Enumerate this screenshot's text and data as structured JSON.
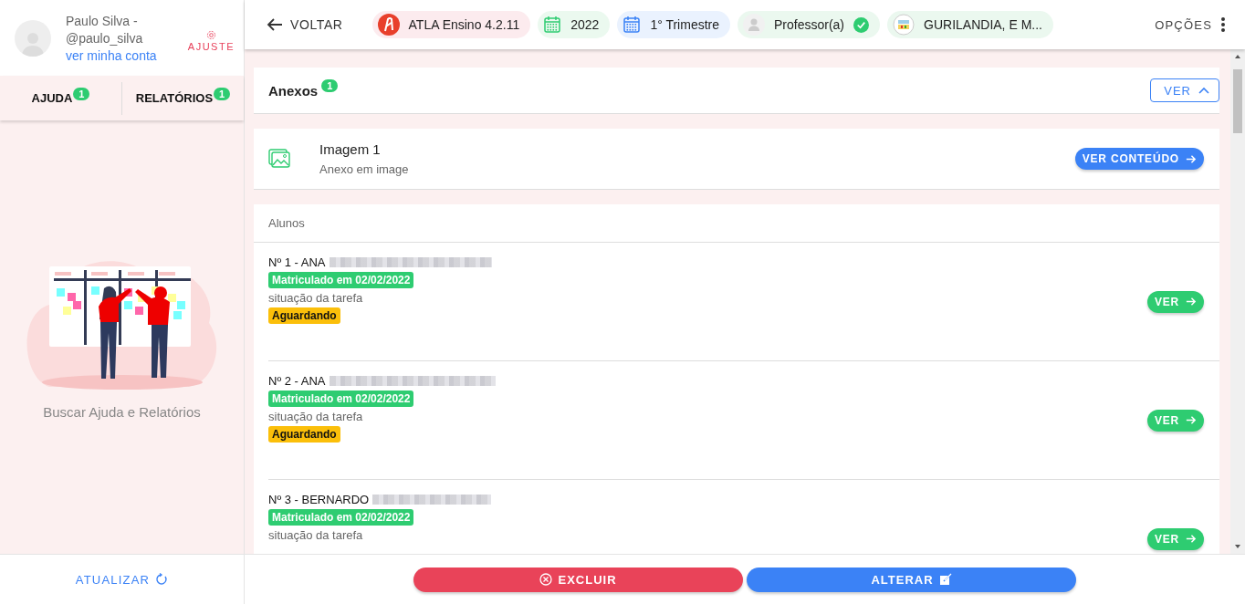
{
  "user": {
    "name": "Paulo Silva -",
    "handle": "@paulo_silva",
    "account_link": "ver minha conta",
    "settings_label": "AJUSTE"
  },
  "sidebar_tabs": [
    {
      "label": "AJUDA",
      "count": "1"
    },
    {
      "label": "RELATÓRIOS",
      "count": "1"
    }
  ],
  "sidebar_message": "Buscar Ajuda e Relatórios",
  "refresh_button": "ATUALIZAR",
  "header": {
    "back": "VOLTAR",
    "options": "OPÇÕES",
    "chips": [
      {
        "kind": "app",
        "label": "ATLA Ensino 4.2.11"
      },
      {
        "kind": "year",
        "label": "2022"
      },
      {
        "kind": "term",
        "label": "1° Trimestre"
      },
      {
        "kind": "role",
        "label": "Professor(a)",
        "verified": true
      },
      {
        "kind": "school",
        "label": "GURILANDIA, E M..."
      }
    ]
  },
  "attachments": {
    "title": "Anexos",
    "count": "1",
    "toggle": "VER",
    "expanded": true,
    "items": [
      {
        "title": "Imagem 1",
        "subtitle": "Anexo em image",
        "action": "VER CONTEÚDO"
      }
    ]
  },
  "students": {
    "title": "Alunos",
    "rows": [
      {
        "name": "Nº 1 - ANA",
        "enrollment": "Matriculado em 02/02/2022",
        "task_label": "situação da tarefa",
        "status": "Aguardando",
        "action": "VER"
      },
      {
        "name": "Nº 2 - ANA",
        "enrollment": "Matriculado em 02/02/2022",
        "task_label": "situação da tarefa",
        "status": "Aguardando",
        "action": "VER"
      },
      {
        "name": "Nº 3 - BERNARDO",
        "enrollment": "Matriculado em 02/02/2022",
        "task_label": "situação da tarefa",
        "action": "VER"
      }
    ]
  },
  "footer_buttons": [
    {
      "kind": "delete",
      "label": "EXCLUIR"
    },
    {
      "kind": "edit",
      "label": "ALTERAR"
    }
  ]
}
